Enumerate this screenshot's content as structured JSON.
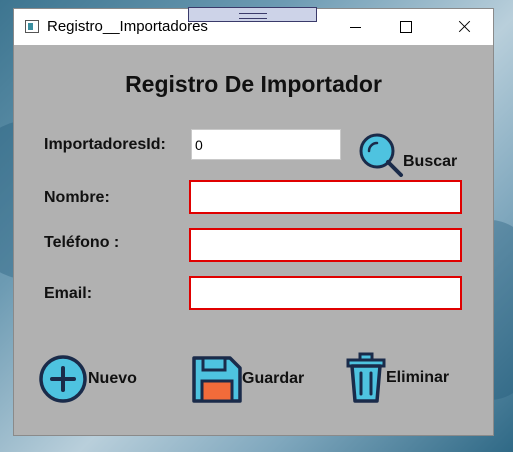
{
  "window": {
    "title": "Registro__Importadores"
  },
  "form": {
    "heading": "Registro De Importador",
    "fields": {
      "importador_id": {
        "label": "ImportadoresId:",
        "value": "0"
      },
      "nombre": {
        "label": "Nombre:",
        "value": ""
      },
      "telefono": {
        "label": "Teléfono :",
        "value": ""
      },
      "email": {
        "label": "Email:",
        "value": ""
      }
    },
    "buscar_label": "Buscar"
  },
  "toolbar": {
    "nuevo_label": "Nuevo",
    "guardar_label": "Guardar",
    "eliminar_label": "Eliminar"
  },
  "colors": {
    "form_bg": "#b1b1b1",
    "invalid_border": "#e00000",
    "icon_fill": "#4ec3e0",
    "icon_stroke": "#1a2b4a",
    "save_accent": "#f26b3a"
  },
  "icons": {
    "search": "search-icon",
    "add": "add-circle-icon",
    "save": "floppy-disk-icon",
    "delete": "trash-can-icon"
  }
}
